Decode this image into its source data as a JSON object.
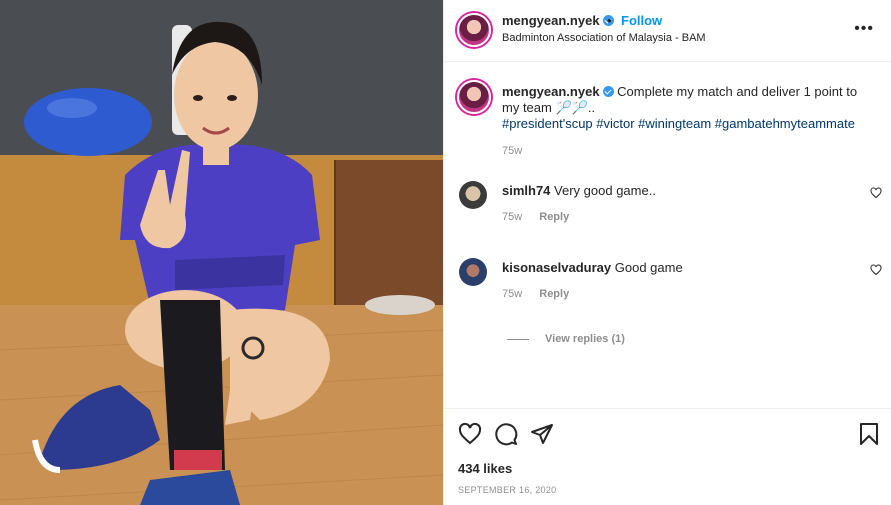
{
  "header": {
    "username": "mengyean.nyek",
    "separator": "•",
    "follow_label": "Follow",
    "location": "Badminton Association of Malaysia - BAM"
  },
  "caption": {
    "username": "mengyean.nyek",
    "text": "Complete my match and deliver 1 point to my team 🏸🏸..",
    "hashtags": "#president'scup #victor #winingteam #gambatehmyteammate",
    "time": "75w"
  },
  "comments": [
    {
      "username": "simlh74",
      "text": "Very good game..",
      "time": "75w",
      "reply_label": "Reply"
    },
    {
      "username": "kisonaselvaduray",
      "text": "Good game",
      "time": "75w",
      "reply_label": "Reply"
    }
  ],
  "view_replies_label": "View replies (1)",
  "likes": "434 likes",
  "date": "SEPTEMBER 16, 2020",
  "colors": {
    "link": "#0095f6",
    "hashtag": "#00376b",
    "muted": "#8e8e8e",
    "verified": "#3897f0"
  },
  "icons": [
    "more-icon",
    "verified-icon",
    "heart-icon",
    "comment-icon",
    "share-icon",
    "bookmark-icon"
  ]
}
